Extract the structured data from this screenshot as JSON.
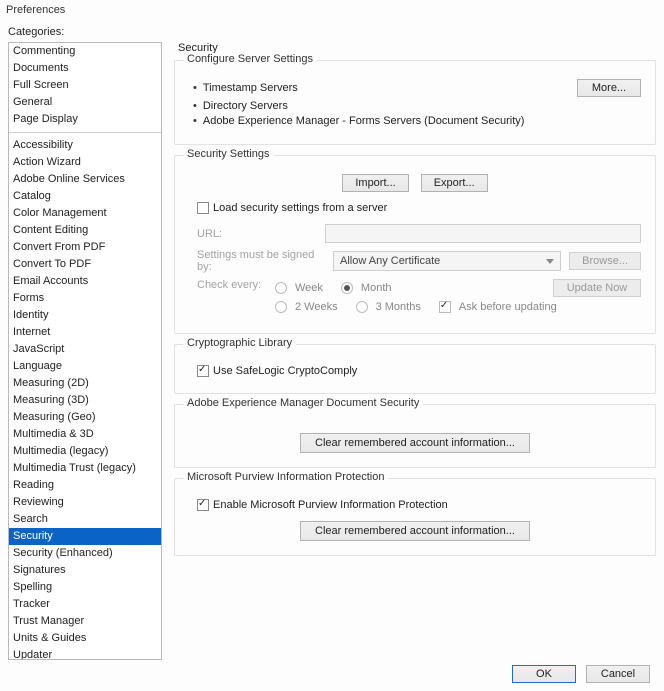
{
  "window": {
    "title": "Preferences"
  },
  "sidebar": {
    "label": "Categories:",
    "group1": [
      "Commenting",
      "Documents",
      "Full Screen",
      "General",
      "Page Display"
    ],
    "group2": [
      "Accessibility",
      "Action Wizard",
      "Adobe Online Services",
      "Catalog",
      "Color Management",
      "Content Editing",
      "Convert From PDF",
      "Convert To PDF",
      "Email Accounts",
      "Forms",
      "Identity",
      "Internet",
      "JavaScript",
      "Language",
      "Measuring (2D)",
      "Measuring (3D)",
      "Measuring (Geo)",
      "Multimedia & 3D",
      "Multimedia (legacy)",
      "Multimedia Trust (legacy)",
      "Reading",
      "Reviewing",
      "Search",
      "Security",
      "Security (Enhanced)",
      "Signatures",
      "Spelling",
      "Tracker",
      "Trust Manager",
      "Units & Guides",
      "Updater"
    ],
    "selected": "Security"
  },
  "panel": {
    "title": "Security",
    "configServer": {
      "legend": "Configure Server Settings",
      "items": [
        "Timestamp Servers",
        "Directory Servers",
        "Adobe Experience Manager - Forms Servers (Document Security)"
      ],
      "more": "More..."
    },
    "secSettings": {
      "legend": "Security Settings",
      "import": "Import...",
      "export": "Export...",
      "loadFromServer": "Load security settings from a server",
      "urlLabel": "URL:",
      "urlValue": "",
      "signedByLabel": "Settings must be signed by:",
      "signedByValue": "Allow Any Certificate",
      "browse": "Browse...",
      "checkEveryLabel": "Check every:",
      "radios": {
        "week": "Week",
        "twoWeeks": "2 Weeks",
        "month": "Month",
        "threeMonths": "3 Months"
      },
      "selectedRadio": "month",
      "askBefore": "Ask before updating",
      "updateNow": "Update Now"
    },
    "crypto": {
      "legend": "Cryptographic Library",
      "useSafeLogic": "Use SafeLogic CryptoComply"
    },
    "aem": {
      "legend": "Adobe Experience Manager Document Security",
      "clear": "Clear remembered account information..."
    },
    "purview": {
      "legend": "Microsoft Purview Information Protection",
      "enable": "Enable Microsoft Purview Information Protection",
      "clear": "Clear remembered account information..."
    }
  },
  "footer": {
    "ok": "OK",
    "cancel": "Cancel"
  }
}
